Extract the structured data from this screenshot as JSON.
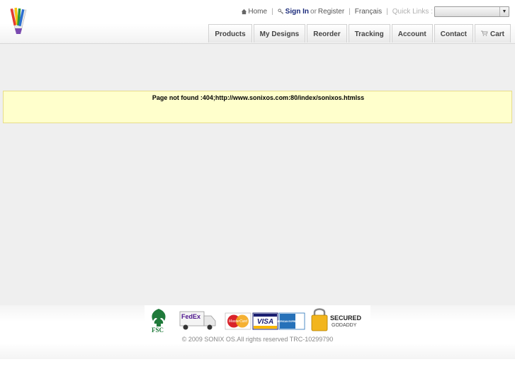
{
  "header": {
    "links": {
      "home": "Home",
      "sign_in": "Sign In",
      "or": "or",
      "register": "Register",
      "language": "Français",
      "quick_links": "Quick Links :"
    },
    "quick_links_select": {
      "value": ""
    },
    "nav": [
      "Products",
      "My Designs",
      "Reorder",
      "Tracking",
      "Account",
      "Contact",
      "Cart"
    ]
  },
  "main": {
    "error_message": "Page not found :404;http://www.sonixos.com:80/index/sonixos.htmlss"
  },
  "footer": {
    "badges": {
      "fsc": "FSC",
      "fedex": "FedEx",
      "mastercard": "MasterCard",
      "visa": "VISA",
      "amex": "AMERICAN EXPRESS",
      "secured_line1": "SECURED",
      "secured_line2": "GODADDY"
    },
    "copyright": "© 2009 SONIX OS.All rights reserved TRC-10299790"
  },
  "colors": {
    "error_bg": "#ffffcc",
    "error_border": "#e7dc8a",
    "signin": "#1a2a7a",
    "content_bg": "#efefef"
  },
  "icons": [
    "logo-icon",
    "home-icon",
    "key-icon",
    "chevron-down-icon",
    "cart-icon"
  ]
}
